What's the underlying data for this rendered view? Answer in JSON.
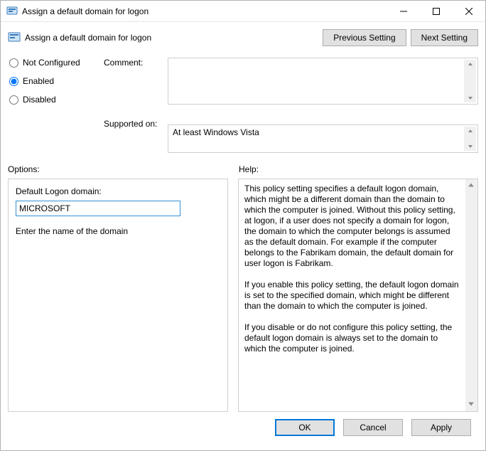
{
  "window": {
    "title": "Assign a default domain for logon"
  },
  "header": {
    "title": "Assign a default domain for logon"
  },
  "nav": {
    "prev": "Previous Setting",
    "next": "Next Setting"
  },
  "state": {
    "not_configured": "Not Configured",
    "enabled": "Enabled",
    "disabled": "Disabled",
    "selected": "enabled"
  },
  "labels": {
    "comment": "Comment:",
    "supported_on": "Supported on:",
    "options": "Options:",
    "help": "Help:"
  },
  "fields": {
    "comment": "",
    "supported_on": "At least Windows Vista"
  },
  "options": {
    "domain_label": "Default Logon domain:",
    "domain_value": "MICROSOFT",
    "domain_desc": "Enter the name of the domain"
  },
  "help": {
    "p1": "This policy setting specifies a default logon domain, which might be a different domain than the domain to which the computer is joined. Without this policy setting, at logon, if a user does not specify a domain for logon, the domain to which the computer belongs is assumed as the default domain. For example if the computer belongs to the Fabrikam domain, the default domain for user logon is Fabrikam.",
    "p2": "If you enable this policy setting, the default logon domain is set to the specified domain, which might be different than the domain to which the computer is joined.",
    "p3": "If you disable or do not configure  this policy setting, the default logon domain is always set to the  domain to which the computer is joined."
  },
  "footer": {
    "ok": "OK",
    "cancel": "Cancel",
    "apply": "Apply"
  }
}
